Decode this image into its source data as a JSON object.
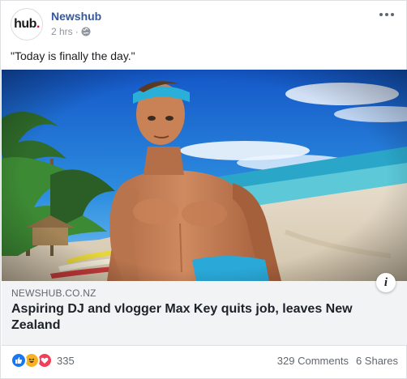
{
  "post": {
    "page_name": "Newshub",
    "time": "2 hrs",
    "separator": "·",
    "privacy_icon": "globe-icon",
    "avatar_logo": {
      "text": "hub",
      "dot": "."
    },
    "text": "\"Today is finally the day.\""
  },
  "link": {
    "domain": "NEWSHUB.CO.NZ",
    "headline": "Aspiring DJ and vlogger Max Key quits job, leaves New Zealand",
    "info_icon": "i"
  },
  "footer": {
    "reaction_icons": [
      "like-icon",
      "haha-icon",
      "love-icon"
    ],
    "reaction_count": "335",
    "comments": "329 Comments",
    "shares": "6 Shares"
  },
  "colors": {
    "page_name": "#365899",
    "like": "#1877f2",
    "haha": "#f7b125",
    "love": "#f33e58",
    "brand_dot": "#e4002b"
  }
}
